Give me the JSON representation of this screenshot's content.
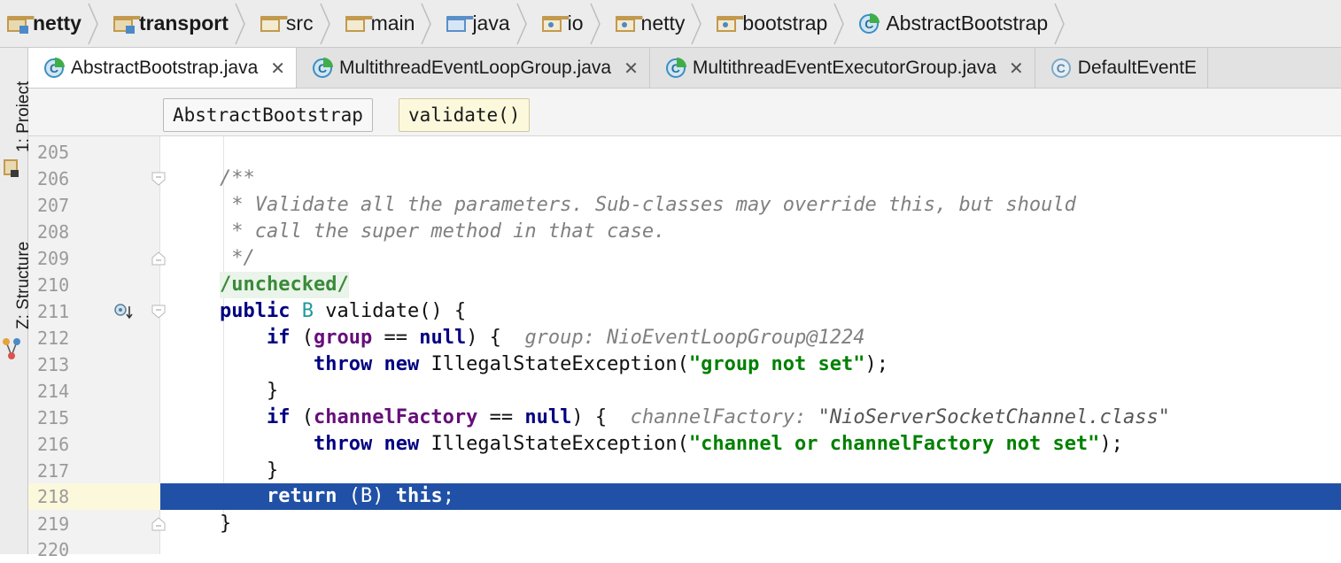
{
  "breadcrumbs": [
    {
      "label": "netty",
      "icon": "module-folder-icon",
      "bold": true
    },
    {
      "label": "transport",
      "icon": "module-folder-icon",
      "bold": true
    },
    {
      "label": "src",
      "icon": "folder-icon",
      "bold": false
    },
    {
      "label": "main",
      "icon": "folder-icon",
      "bold": false
    },
    {
      "label": "java",
      "icon": "source-root-folder-icon",
      "bold": false
    },
    {
      "label": "io",
      "icon": "package-folder-icon",
      "bold": false
    },
    {
      "label": "netty",
      "icon": "package-folder-icon",
      "bold": false
    },
    {
      "label": "bootstrap",
      "icon": "package-folder-icon",
      "bold": false
    },
    {
      "label": "AbstractBootstrap",
      "icon": "class-icon",
      "bold": false
    }
  ],
  "left_strip": {
    "project_label": "1: Project",
    "structure_label": "Z: Structure"
  },
  "tabs": [
    {
      "label": "AbstractBootstrap.java",
      "active": true,
      "close": "✕"
    },
    {
      "label": "MultithreadEventLoopGroup.java",
      "active": false,
      "close": "✕"
    },
    {
      "label": "MultithreadEventExecutorGroup.java",
      "active": false,
      "close": "✕"
    },
    {
      "label": "DefaultEventE",
      "active": false,
      "close": ""
    }
  ],
  "structure_path": {
    "class_name": "AbstractBootstrap",
    "method_name": "validate()"
  },
  "editor": {
    "current_line": 218,
    "lines": [
      {
        "n": "205",
        "text": ""
      },
      {
        "n": "206",
        "text": "/**"
      },
      {
        "n": "207",
        "text": " * Validate all the parameters. Sub-classes may override this, but should"
      },
      {
        "n": "208",
        "text": " * call the super method in that case."
      },
      {
        "n": "209",
        "text": " */"
      },
      {
        "n": "210",
        "text": "/unchecked/"
      },
      {
        "n": "211",
        "text": "public B validate() {"
      },
      {
        "n": "212",
        "text": "    if (group == null) {",
        "hint": "group: NioEventLoopGroup@1224"
      },
      {
        "n": "213",
        "text": "        throw new IllegalStateException(\"group not set\");"
      },
      {
        "n": "214",
        "text": "    }"
      },
      {
        "n": "215",
        "text": "    if (channelFactory == null) {",
        "hint_label": "channelFactory:",
        "hint_value": "\"NioServerSocketChannel.class\""
      },
      {
        "n": "216",
        "text": "        throw new IllegalStateException(\"channel or channelFactory not set\");"
      },
      {
        "n": "217",
        "text": "    }"
      },
      {
        "n": "218",
        "text": "    return (B) this;"
      },
      {
        "n": "219",
        "text": "}"
      },
      {
        "n": "220",
        "text": ""
      }
    ]
  },
  "code_tokens": {
    "l206": "/**",
    "l207": " * Validate all the parameters. Sub-classes may override this, but should",
    "l208": " * call the super method in that case.",
    "l209": " */",
    "l210": "/unchecked/",
    "l211_kw": "public",
    "l211_type": "B",
    "l211_rest": " validate() {",
    "l212_kw": "if",
    "l212_a": " (",
    "l212_fld": "group",
    "l212_b": " == ",
    "l212_null": "null",
    "l212_c": ") {",
    "l212_hint": "group: NioEventLoopGroup@1224",
    "l213_throw": "throw",
    "l213_new": "new",
    "l213_a": " IllegalStateException(",
    "l213_str": "\"group not set\"",
    "l213_b": ");",
    "l214": "}",
    "l215_kw": "if",
    "l215_a": " (",
    "l215_fld": "channelFactory",
    "l215_b": " == ",
    "l215_null": "null",
    "l215_c": ") {",
    "l215_hint_label": "channelFactory:",
    "l215_hint_value": "\"NioServerSocketChannel.class\"",
    "l216_throw": "throw",
    "l216_new": "new",
    "l216_a": " IllegalStateException(",
    "l216_str": "\"channel or channelFactory not set\"",
    "l216_b": ");",
    "l217": "}",
    "l218_kw": "return",
    "l218_a": " (B) ",
    "l218_this": "this",
    "l218_b": ";",
    "l219": "}"
  },
  "colors": {
    "selection": "#2151a6",
    "keyword": "#000080",
    "field": "#660e7a",
    "string": "#008000",
    "comment": "#808080",
    "type_param": "#20999d"
  }
}
